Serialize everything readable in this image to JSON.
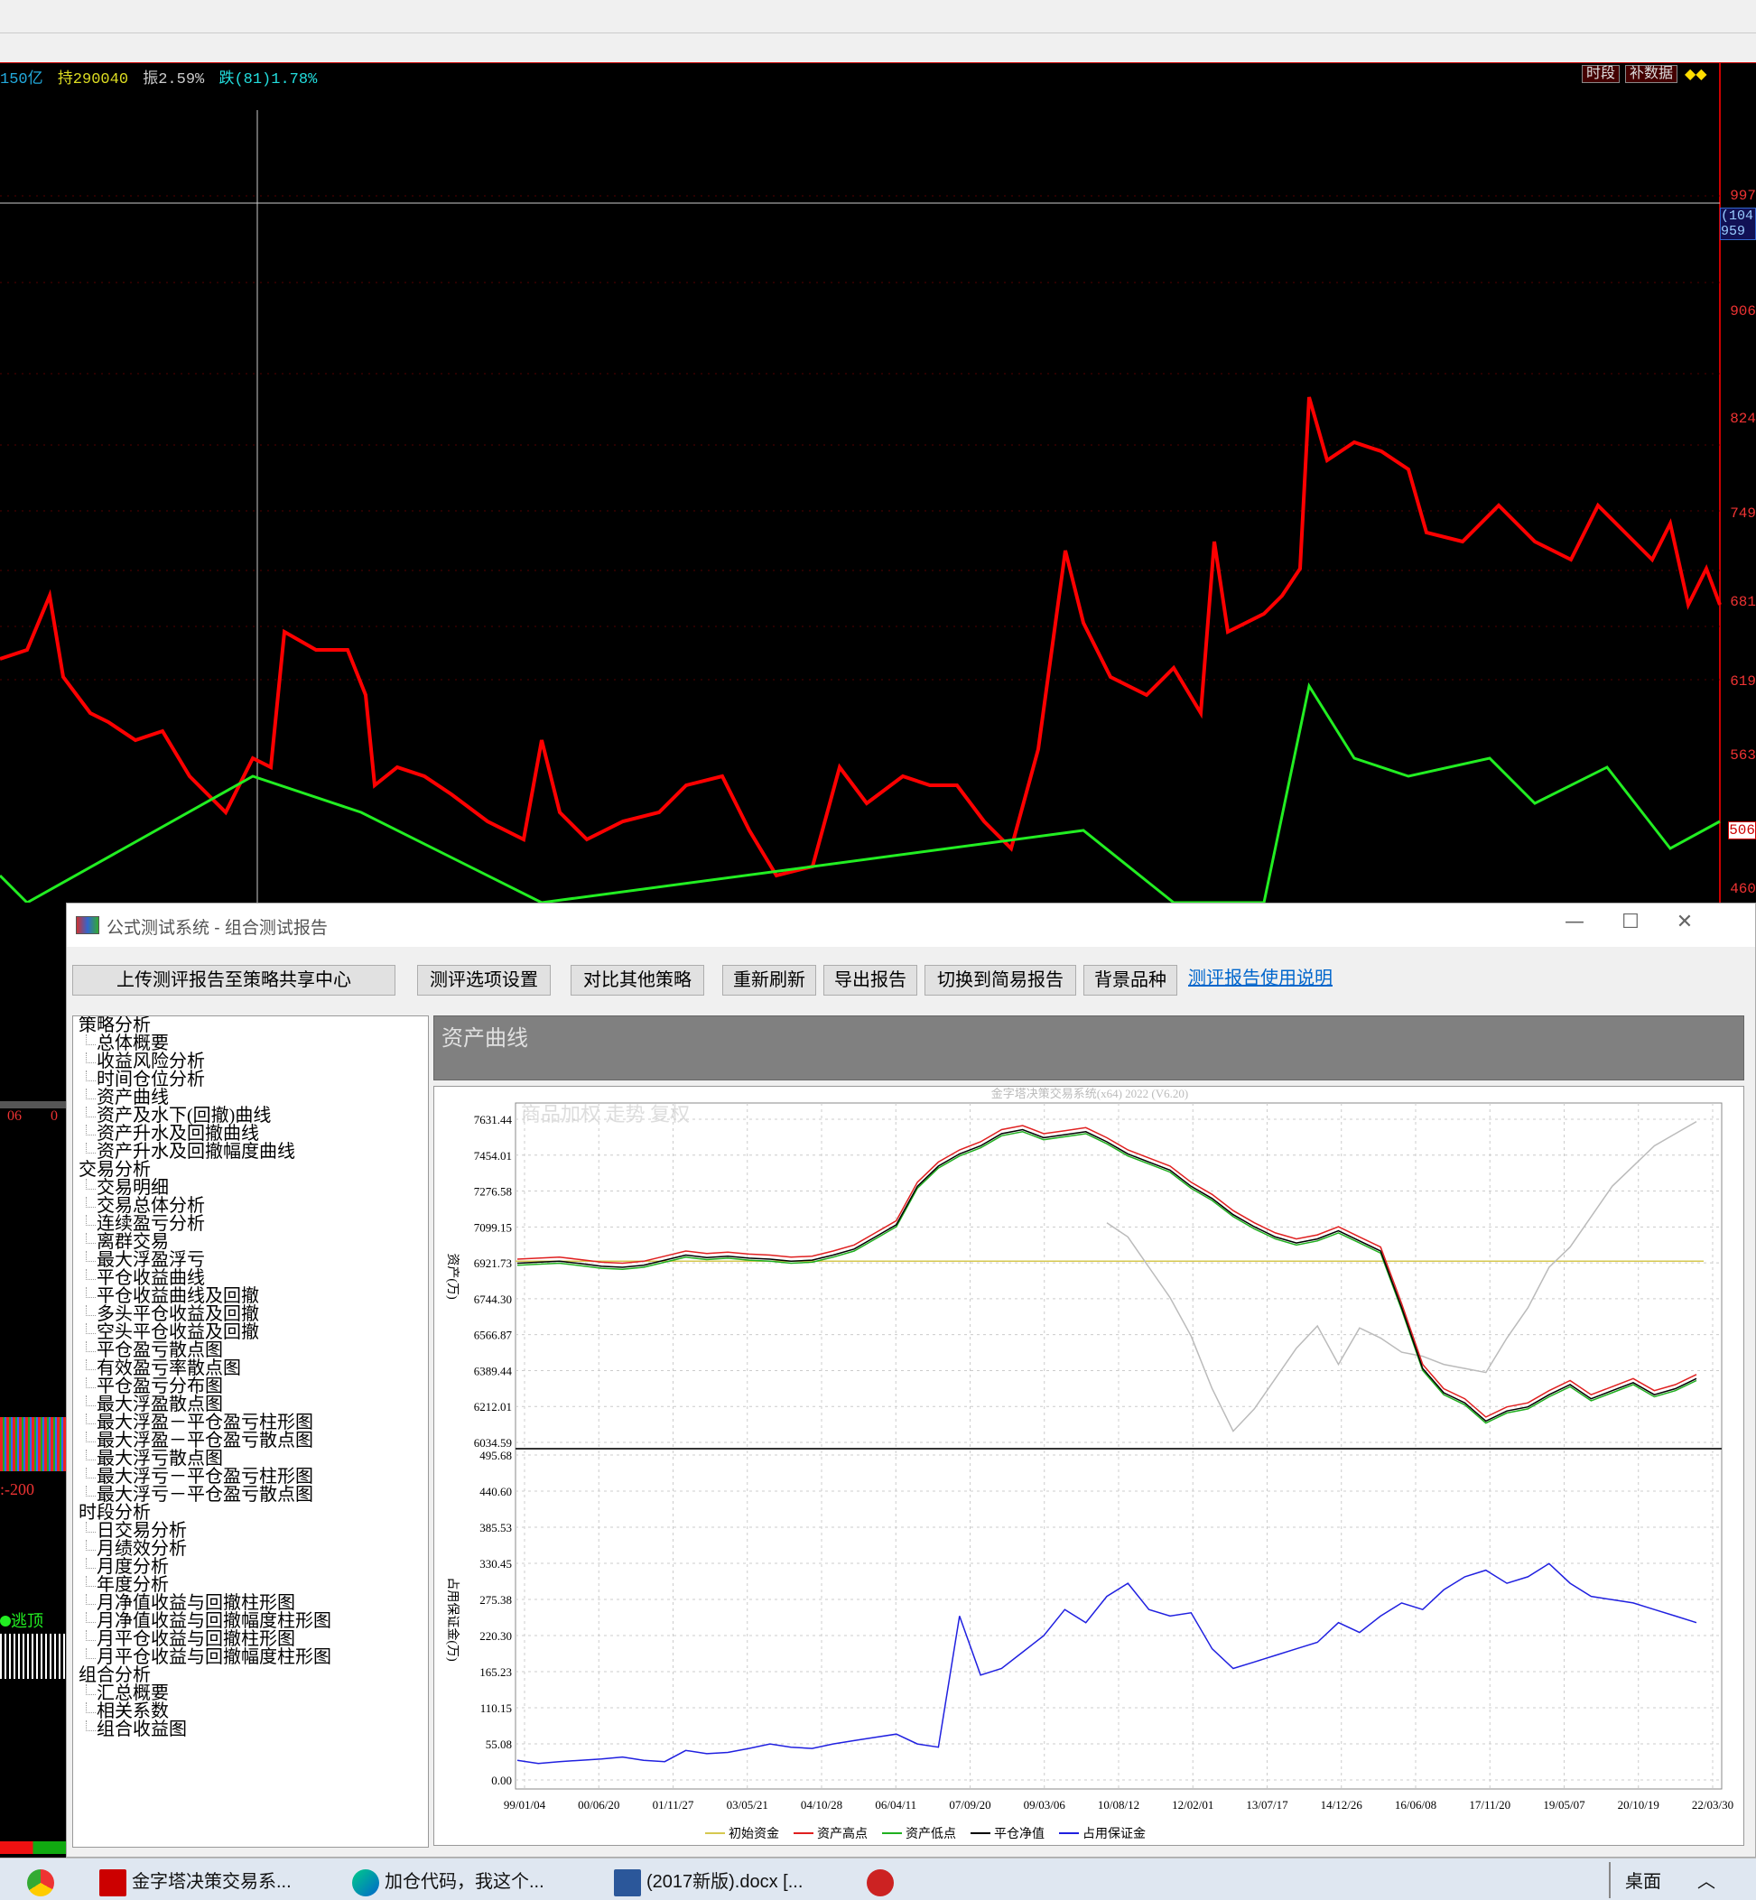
{
  "info_bar": {
    "part1": "150亿",
    "part2": "持290040",
    "part3": "振2.59%",
    "part4": "跌(81)1.78%"
  },
  "kline_buttons": {
    "period": "时段",
    "fill": "补数据"
  },
  "price_labels": [
    "997",
    "906",
    "824",
    "749",
    "681",
    "619",
    "563",
    "506",
    "460"
  ],
  "price_box": [
    "(104",
    "959"
  ],
  "left_strip": {
    "date1": "06",
    "date2": "0",
    "indicator": ":-200",
    "signal": "逃顶"
  },
  "dialog": {
    "title": "公式测试系统 - 组合测试报告",
    "buttons": {
      "upload": "上传测评报告至策略共享中心",
      "options": "测评选项设置",
      "compare": "对比其他策略",
      "refresh": "重新刷新",
      "export": "导出报告",
      "switch": "切换到简易报告",
      "background": "背景品种"
    },
    "help_link": "测评报告使用说明",
    "section_title": "资产曲线",
    "tree": [
      {
        "label": "策略分析",
        "items": [
          "总体概要",
          "收益风险分析",
          "时间仓位分析",
          "资产曲线",
          "资产及水下(回撤)曲线",
          "资产升水及回撤曲线",
          "资产升水及回撤幅度曲线"
        ]
      },
      {
        "label": "交易分析",
        "items": [
          "交易明细",
          "交易总体分析",
          "连续盈亏分析",
          "离群交易",
          "最大浮盈浮亏",
          "平仓收益曲线",
          "平仓收益曲线及回撤",
          "多头平仓收益及回撤",
          "空头平仓收益及回撤",
          "平仓盈亏散点图",
          "有效盈亏率散点图",
          "平仓盈亏分布图",
          "最大浮盈散点图",
          "最大浮盈－平仓盈亏柱形图",
          "最大浮盈－平仓盈亏散点图",
          "最大浮亏散点图",
          "最大浮亏－平仓盈亏柱形图",
          "最大浮亏－平仓盈亏散点图"
        ]
      },
      {
        "label": "时段分析",
        "items": [
          "日交易分析",
          "月绩效分析",
          "月度分析",
          "年度分析",
          "月净值收益与回撤柱形图",
          "月净值收益与回撤幅度柱形图",
          "月平仓收益与回撤柱形图",
          "月平仓收益与回撤幅度柱形图"
        ]
      },
      {
        "label": "组合分析",
        "items": [
          "汇总概要",
          "相关系数",
          "组合收益图"
        ]
      }
    ]
  },
  "chart_data": {
    "type": "line",
    "watermark": "金字塔决策交易系统(x64) 2022 (V6.20)",
    "overlay_text": "商品加权 走势 复权",
    "upper": {
      "ylabel": "资产(万)",
      "yticks": [
        "7631.44",
        "7454.01",
        "7276.58",
        "7099.15",
        "6921.73",
        "6744.30",
        "6566.87",
        "6389.44",
        "6212.01",
        "6034.59"
      ],
      "ylim": [
        6034.59,
        7631.44
      ],
      "initial_capital": 6930
    },
    "lower": {
      "ylabel": "占用保证金(万)",
      "yticks": [
        "495.68",
        "440.60",
        "385.53",
        "330.45",
        "275.38",
        "220.30",
        "165.23",
        "110.15",
        "55.08",
        "0.00"
      ],
      "ylim": [
        0,
        495.68
      ]
    },
    "xticks": [
      "99/01/04",
      "00/06/20",
      "01/11/27",
      "03/05/21",
      "04/10/28",
      "06/04/11",
      "07/09/20",
      "09/03/06",
      "10/08/12",
      "12/02/01",
      "13/07/17",
      "14/12/26",
      "16/06/08",
      "17/11/20",
      "19/05/07",
      "20/10/19",
      "22/03/30"
    ],
    "legend": [
      {
        "name": "初始资金",
        "color": "#d6c850"
      },
      {
        "name": "资产高点",
        "color": "#e02020"
      },
      {
        "name": "资产低点",
        "color": "#20b020"
      },
      {
        "name": "平仓净值",
        "color": "#000000"
      },
      {
        "name": "占用保证金",
        "color": "#2020e0"
      }
    ],
    "series_nav": [
      6920,
      6925,
      6930,
      6918,
      6905,
      6900,
      6910,
      6935,
      6960,
      6948,
      6955,
      6945,
      6940,
      6930,
      6935,
      6960,
      6990,
      7050,
      7110,
      7300,
      7400,
      7460,
      7500,
      7560,
      7580,
      7540,
      7555,
      7570,
      7520,
      7460,
      7420,
      7380,
      7300,
      7240,
      7160,
      7100,
      7050,
      7020,
      7040,
      7080,
      7030,
      6980,
      6700,
      6400,
      6280,
      6230,
      6140,
      6190,
      6210,
      6270,
      6320,
      6250,
      6290,
      6330,
      6270,
      6300,
      6350
    ],
    "series_bg": [
      null,
      null,
      null,
      null,
      null,
      null,
      null,
      null,
      null,
      null,
      null,
      null,
      null,
      null,
      null,
      null,
      null,
      null,
      null,
      null,
      null,
      null,
      null,
      null,
      null,
      null,
      null,
      null,
      7120,
      7050,
      6900,
      6750,
      6560,
      6300,
      6090,
      6200,
      6350,
      6500,
      6610,
      6420,
      6600,
      6550,
      6480,
      6460,
      6420,
      6400,
      6380,
      6550,
      6700,
      6900,
      7000,
      7150,
      7300,
      7400,
      7500,
      7560,
      7620
    ],
    "series_margin": [
      30,
      25,
      28,
      30,
      32,
      35,
      30,
      28,
      45,
      40,
      42,
      48,
      55,
      50,
      48,
      55,
      60,
      65,
      70,
      55,
      50,
      250,
      160,
      170,
      195,
      220,
      260,
      240,
      280,
      300,
      260,
      250,
      255,
      200,
      170,
      180,
      190,
      200,
      210,
      240,
      225,
      250,
      270,
      260,
      290,
      310,
      320,
      300,
      310,
      330,
      300,
      280,
      275,
      270,
      260,
      250,
      240
    ]
  },
  "taskbar": {
    "items": [
      "金字塔决策交易系...",
      "加仓代码，我这个...",
      "(2017新版).docx [..."
    ],
    "desktop": "桌面"
  }
}
